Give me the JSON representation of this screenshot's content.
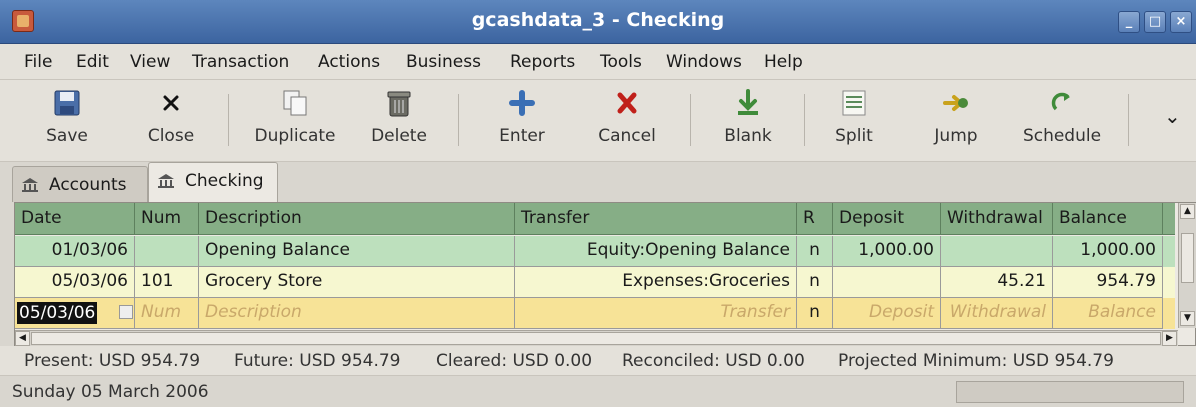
{
  "window": {
    "title": "gcashdata_3 - Checking",
    "minimize_glyph": "_",
    "maximize_glyph": "□",
    "close_glyph": "×"
  },
  "menubar": {
    "items": [
      "File",
      "Edit",
      "View",
      "Transaction",
      "Actions",
      "Business",
      "Reports",
      "Tools",
      "Windows",
      "Help"
    ]
  },
  "toolbar": {
    "buttons": [
      {
        "label": "Save",
        "icon": "save-icon"
      },
      {
        "label": "Close",
        "icon": "close-icon"
      },
      {
        "label": "Duplicate",
        "icon": "duplicate-icon"
      },
      {
        "label": "Delete",
        "icon": "trash-icon"
      },
      {
        "label": "Enter",
        "icon": "plus-icon"
      },
      {
        "label": "Cancel",
        "icon": "cancel-x-icon"
      },
      {
        "label": "Blank",
        "icon": "blank-down-arrow-icon"
      },
      {
        "label": "Split",
        "icon": "split-icon"
      },
      {
        "label": "Jump",
        "icon": "jump-icon"
      },
      {
        "label": "Schedule",
        "icon": "schedule-icon"
      }
    ],
    "overflow_glyph": "⌄"
  },
  "tabs": [
    {
      "label": "Accounts",
      "icon": "bank-icon",
      "active": false
    },
    {
      "label": "Checking",
      "icon": "bank-icon",
      "active": true
    }
  ],
  "register": {
    "columns": [
      "Date",
      "Num",
      "Description",
      "Transfer",
      "R",
      "Deposit",
      "Withdrawal",
      "Balance"
    ],
    "rows": [
      {
        "date": "01/03/06",
        "num": "",
        "description": "Opening Balance",
        "transfer": "Equity:Opening Balance",
        "r": "n",
        "deposit": "1,000.00",
        "withdrawal": "",
        "balance": "1,000.00"
      },
      {
        "date": "05/03/06",
        "num": "101",
        "description": "Grocery Store",
        "transfer": "Expenses:Groceries",
        "r": "n",
        "deposit": "",
        "withdrawal": "45.21",
        "balance": "954.79"
      }
    ],
    "blank_row": {
      "date": "05/03/06",
      "num_placeholder": "Num",
      "description_placeholder": "Description",
      "transfer_placeholder": "Transfer",
      "r": "n",
      "deposit_placeholder": "Deposit",
      "withdrawal_placeholder": "Withdrawal",
      "balance_placeholder": "Balance"
    }
  },
  "summary": {
    "present": "Present: USD 954.79",
    "future": "Future: USD 954.79",
    "cleared": "Cleared: USD 0.00",
    "reconciled": "Reconciled: USD 0.00",
    "projected_minimum": "Projected Minimum: USD 954.79"
  },
  "statusbar": {
    "text": "Sunday 05 March 2006"
  },
  "colors": {
    "titlebar": "#4a72ab",
    "header_green": "#86ae86",
    "row_green": "#bde0bd",
    "row_yellow": "#f6f7d0",
    "row_blank": "#f7e397"
  }
}
